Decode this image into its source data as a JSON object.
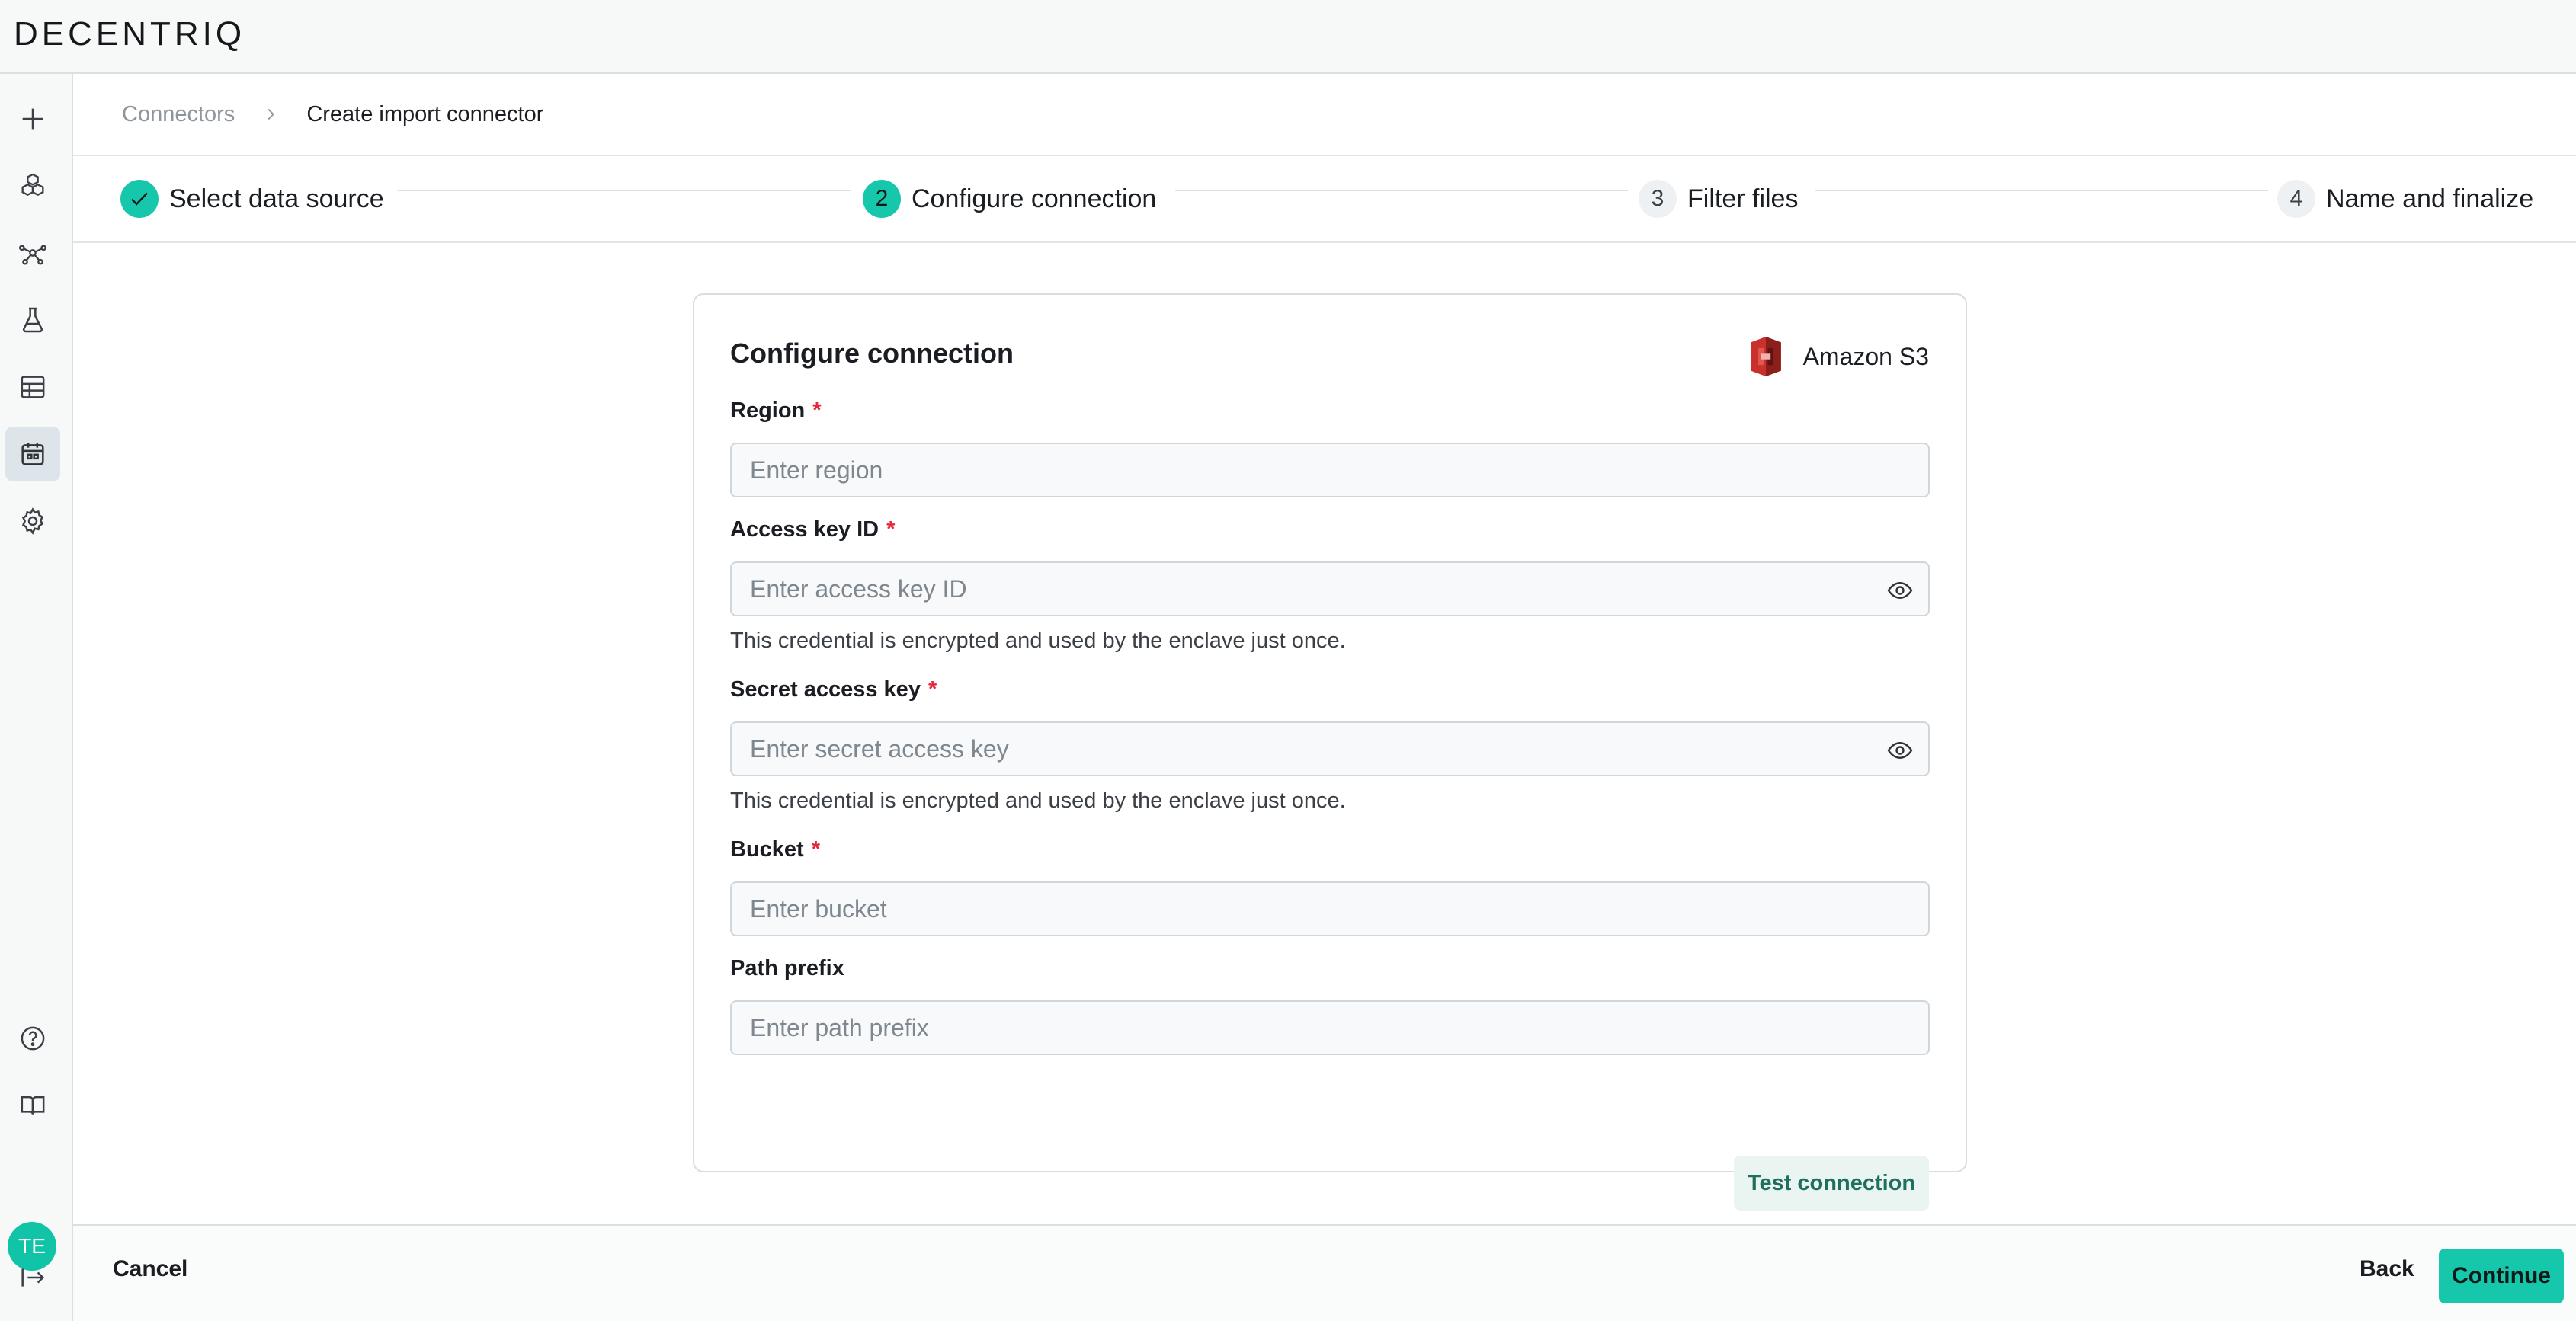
{
  "app": {
    "logo": "DECENTRIQ",
    "user_initials": "TE"
  },
  "sidebar": {
    "items": [
      {
        "name": "new",
        "icon": "plus-icon"
      },
      {
        "name": "datarooms",
        "icon": "cube-cluster-icon"
      },
      {
        "name": "network",
        "icon": "network-icon"
      },
      {
        "name": "lab",
        "icon": "flask-icon"
      },
      {
        "name": "datasets",
        "icon": "table-icon"
      },
      {
        "name": "connectors",
        "icon": "calendar-grid-icon",
        "active": true
      },
      {
        "name": "settings",
        "icon": "gear-icon"
      }
    ],
    "bottom": [
      {
        "name": "help",
        "icon": "help-circle-icon"
      },
      {
        "name": "docs",
        "icon": "book-icon"
      },
      {
        "name": "collapse",
        "icon": "collapse-arrow-icon"
      }
    ]
  },
  "breadcrumb": {
    "parent": "Connectors",
    "current": "Create import connector"
  },
  "stepper": {
    "steps": [
      {
        "label": "Select data source",
        "status": "done"
      },
      {
        "number": "2",
        "label": "Configure connection",
        "status": "current"
      },
      {
        "number": "3",
        "label": "Filter files",
        "status": "todo"
      },
      {
        "number": "4",
        "label": "Name and finalize",
        "status": "todo"
      }
    ]
  },
  "form": {
    "title": "Configure connection",
    "provider": "Amazon S3",
    "required_mark": "*",
    "fields": {
      "region": {
        "label": "Region",
        "placeholder": "Enter region"
      },
      "access_key": {
        "label": "Access key ID",
        "placeholder": "Enter access key ID",
        "helper": "This credential is encrypted and used by the enclave just once."
      },
      "secret_key": {
        "label": "Secret access key",
        "placeholder": "Enter secret access key",
        "helper": "This credential is encrypted and used by the enclave just once."
      },
      "bucket": {
        "label": "Bucket",
        "placeholder": "Enter bucket"
      },
      "path_prefix": {
        "label": "Path prefix",
        "placeholder": "Enter path prefix"
      }
    },
    "test_button": "Test connection"
  },
  "footer": {
    "cancel": "Cancel",
    "back": "Back",
    "continue": "Continue"
  },
  "colors": {
    "accent": "#17c7ab",
    "required": "#e5293c",
    "s3_red": "#c7302b"
  }
}
